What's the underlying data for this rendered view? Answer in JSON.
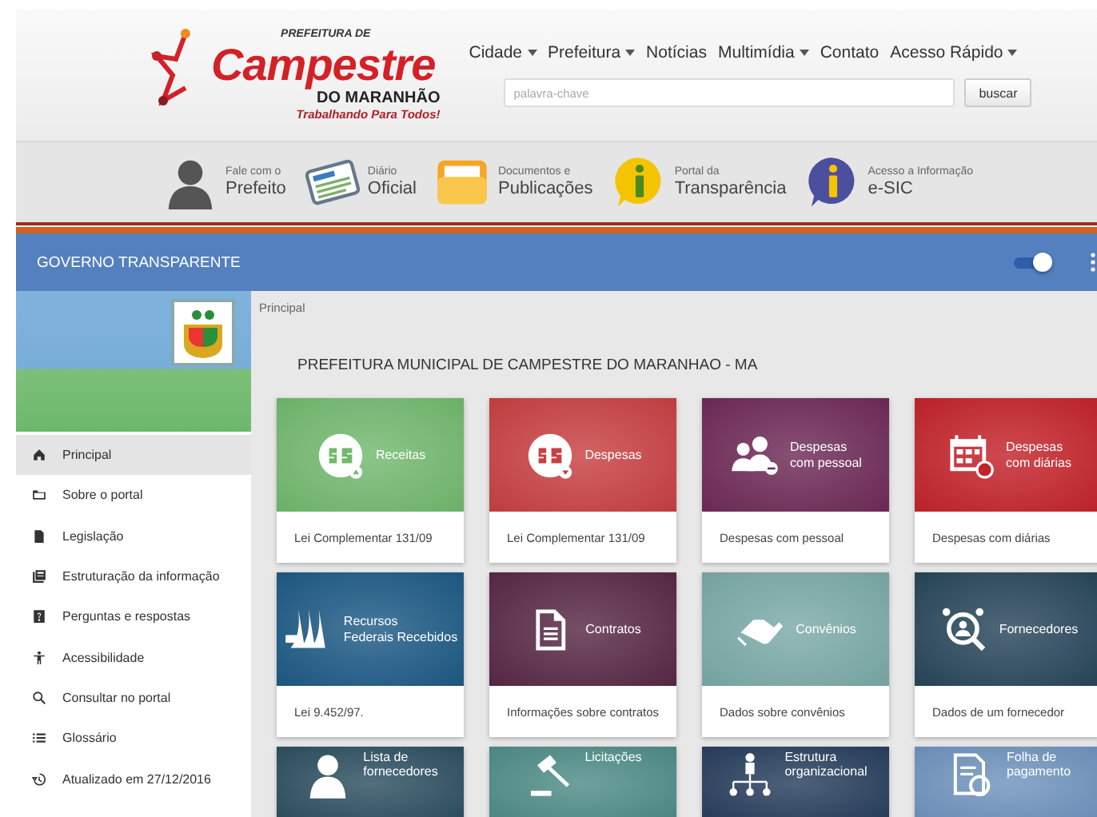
{
  "logo": {
    "top": "PREFEITURA DE",
    "name": "Campestre",
    "region": "DO MARANHÃO",
    "slogan": "Trabalhando Para Todos!"
  },
  "nav": [
    {
      "label": "Cidade",
      "dropdown": true
    },
    {
      "label": "Prefeitura",
      "dropdown": true
    },
    {
      "label": "Notícias",
      "dropdown": false
    },
    {
      "label": "Multimídia",
      "dropdown": true
    },
    {
      "label": "Contato",
      "dropdown": false
    },
    {
      "label": "Acesso Rápido",
      "dropdown": true
    }
  ],
  "search": {
    "placeholder": "palavra-chave",
    "button": "buscar"
  },
  "shortcuts": [
    {
      "kind": "person",
      "small": "Fale com o",
      "big": "Prefeito"
    },
    {
      "kind": "newspaper",
      "small": "Diário",
      "big": "Oficial"
    },
    {
      "kind": "folder",
      "small": "Documentos e",
      "big": "Publicações"
    },
    {
      "kind": "info-yellow",
      "small": "Portal da",
      "big": "Transparência"
    },
    {
      "kind": "info-blue",
      "small": "Acesso a Informação",
      "big": "e-SIC"
    }
  ],
  "appbar": {
    "title": "GOVERNO TRANSPARENTE",
    "toggle_on": true
  },
  "sidebar": [
    {
      "kind": "home",
      "label": "Principal",
      "selected": true
    },
    {
      "kind": "folder",
      "label": "Sobre o portal",
      "selected": false
    },
    {
      "kind": "file",
      "label": "Legislação",
      "selected": false
    },
    {
      "kind": "book",
      "label": "Estruturação da informação",
      "selected": false
    },
    {
      "kind": "help",
      "label": "Perguntas e respostas",
      "selected": false
    },
    {
      "kind": "person",
      "label": "Acessibilidade",
      "selected": false
    },
    {
      "kind": "search",
      "label": "Consultar no portal",
      "selected": false
    },
    {
      "kind": "list",
      "label": "Glossário",
      "selected": false
    },
    {
      "kind": "history",
      "label": "Atualizado em 27/12/2016",
      "selected": false
    }
  ],
  "breadcrumb": "Principal",
  "page_title": "PREFEITURA MUNICIPAL DE CAMPESTRE DO MARANHAO - MA",
  "cards": [
    {
      "kind": "money-up",
      "color": "#72b96e",
      "title": [
        "Receitas"
      ],
      "footer": "Lei Complementar 131/09"
    },
    {
      "kind": "money-down",
      "color": "#c84042",
      "title": [
        "Despesas"
      ],
      "footer": "Lei Complementar 131/09"
    },
    {
      "kind": "people",
      "color": "#6e2a57",
      "title": [
        "Despesas",
        "com pessoal"
      ],
      "footer": "Despesas com pessoal"
    },
    {
      "kind": "calendar",
      "color": "#c3232a",
      "title": [
        "Despesas",
        "com diárias"
      ],
      "footer": "Despesas com diárias"
    },
    {
      "kind": "columns",
      "color": "#1d5a85",
      "title": [
        "Recursos",
        "Federais Recebidos"
      ],
      "footer": "Lei 9.452/97."
    },
    {
      "kind": "document",
      "color": "#582845",
      "title": [
        "Contratos"
      ],
      "footer": "Informações sobre contratos"
    },
    {
      "kind": "handshake",
      "color": "#7aaaa8",
      "title": [
        "Convênios"
      ],
      "footer": "Dados sobre convênios"
    },
    {
      "kind": "magnifier",
      "color": "#27465a",
      "title": [
        "Fornecedores"
      ],
      "footer": "Dados de um fornecedor"
    },
    {
      "kind": "person",
      "color": "#2d4f60",
      "title": [
        "Lista de",
        "fornecedores"
      ]
    },
    {
      "kind": "gavel",
      "color": "#4e8c87",
      "title": [
        "Licitações"
      ]
    },
    {
      "kind": "org",
      "color": "#273e5c",
      "title": [
        "Estrutura",
        "organizacional"
      ]
    },
    {
      "kind": "payroll",
      "color": "#6f93bd",
      "title": [
        "Folha de",
        "pagamento"
      ]
    }
  ]
}
